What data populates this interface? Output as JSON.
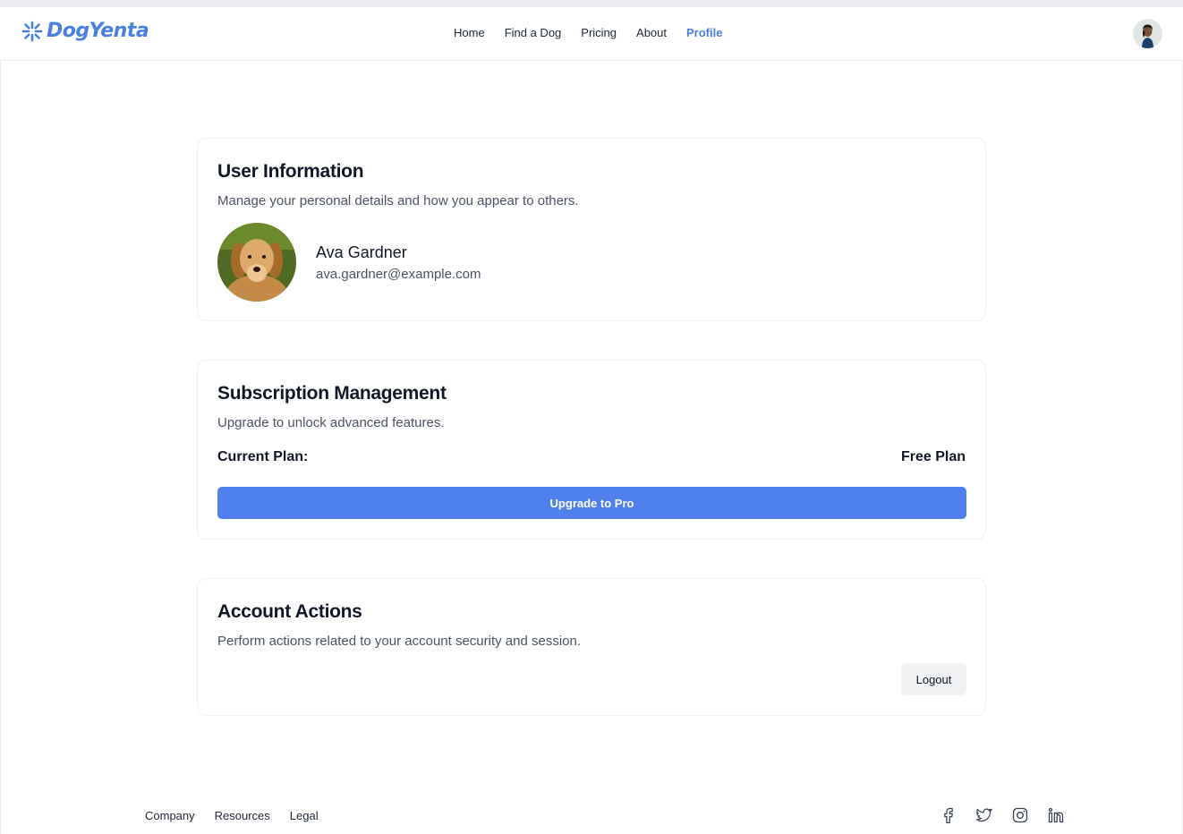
{
  "brand": {
    "name": "DogYenta",
    "color": "#4a7fe3"
  },
  "nav": {
    "links": [
      {
        "label": "Home"
      },
      {
        "label": "Find a Dog"
      },
      {
        "label": "Pricing"
      },
      {
        "label": "About"
      },
      {
        "label": "Profile",
        "active": true
      }
    ],
    "avatar_icon": "user-avatar"
  },
  "user_info": {
    "title": "User Information",
    "description": "Manage your personal details and how you appear to others.",
    "name": "Ava Gardner",
    "email": "ava.gardner@example.com",
    "photo_icon": "golden-retriever-photo"
  },
  "subscription": {
    "title": "Subscription Management",
    "description": "Upgrade to unlock advanced features.",
    "current_plan_label": "Current Plan:",
    "current_plan_value": "Free Plan",
    "upgrade_label": "Upgrade to Pro",
    "accent": "#4f80ee"
  },
  "account": {
    "title": "Account Actions",
    "description": "Perform actions related to your account security and session.",
    "logout_label": "Logout"
  },
  "footer": {
    "links": [
      {
        "label": "Company"
      },
      {
        "label": "Resources"
      },
      {
        "label": "Legal"
      }
    ],
    "social": [
      "facebook-icon",
      "twitter-icon",
      "instagram-icon",
      "linkedin-icon"
    ]
  }
}
